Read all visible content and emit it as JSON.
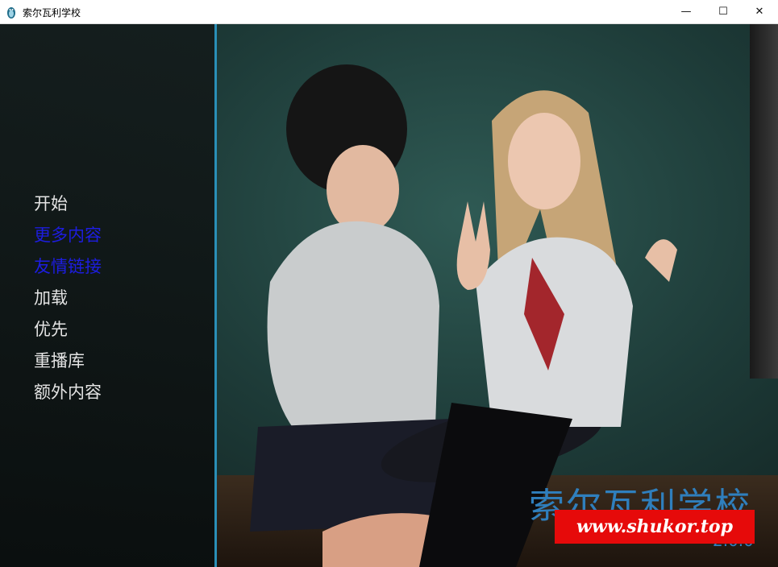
{
  "window": {
    "title": "索尔瓦利学校",
    "app_icon": "penguin-icon",
    "controls": {
      "minimize": "—",
      "maximize": "☐",
      "close": "✕"
    }
  },
  "menu": {
    "items": [
      {
        "label": "开始",
        "highlighted": false
      },
      {
        "label": "更多内容",
        "highlighted": true
      },
      {
        "label": "友情链接",
        "highlighted": true
      },
      {
        "label": "加载",
        "highlighted": false
      },
      {
        "label": "优先",
        "highlighted": false
      },
      {
        "label": "重播库",
        "highlighted": false
      },
      {
        "label": "额外内容",
        "highlighted": false
      }
    ]
  },
  "game": {
    "title": "索尔瓦利学校",
    "version": "2.0.0"
  },
  "watermark": {
    "text": "www.shukor.top"
  },
  "colors": {
    "menu_text": "#e4e4e4",
    "menu_highlight": "#1d1de0",
    "accent_blue": "#2f7fbd",
    "divider": "#2a8fb7",
    "watermark_bg": "#e60a0a"
  }
}
